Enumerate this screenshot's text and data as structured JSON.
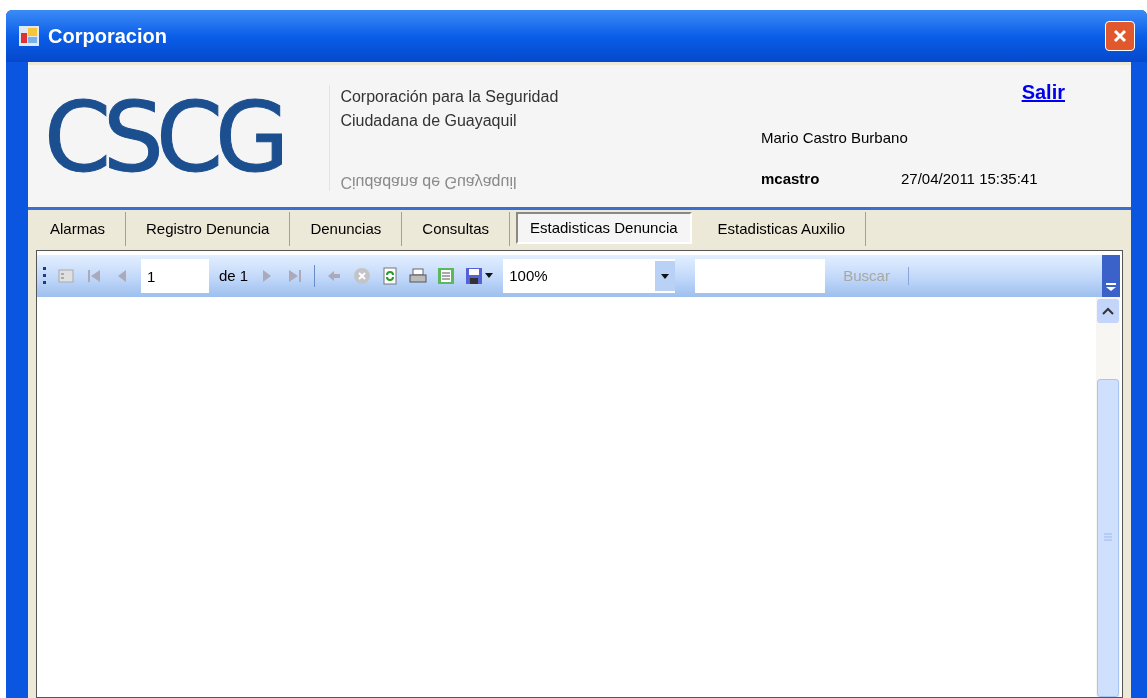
{
  "window": {
    "title": "Corporacion"
  },
  "header": {
    "logo": "CSCG",
    "org_lines": [
      "Corporación para la Seguridad",
      "Ciudadana de Guayaquil"
    ],
    "reflection": "Ciudadana de Guayaquil",
    "logout_link": "Salir",
    "user_name": "Mario Castro Burbano",
    "username": "mcastro",
    "datetime": "27/04/2011 15:35:41"
  },
  "tabs": [
    {
      "label": "Alarmas",
      "selected": false
    },
    {
      "label": "Registro Denuncia",
      "selected": false
    },
    {
      "label": "Denuncias",
      "selected": false
    },
    {
      "label": "Consultas",
      "selected": false
    },
    {
      "label": "Estadisticas Denuncia",
      "selected": true
    },
    {
      "label": "Estadisticas Auxilio",
      "selected": false
    }
  ],
  "toolbar": {
    "page_value": "1",
    "page_of": "de 1",
    "zoom": "100%",
    "search_button": "Buscar"
  }
}
